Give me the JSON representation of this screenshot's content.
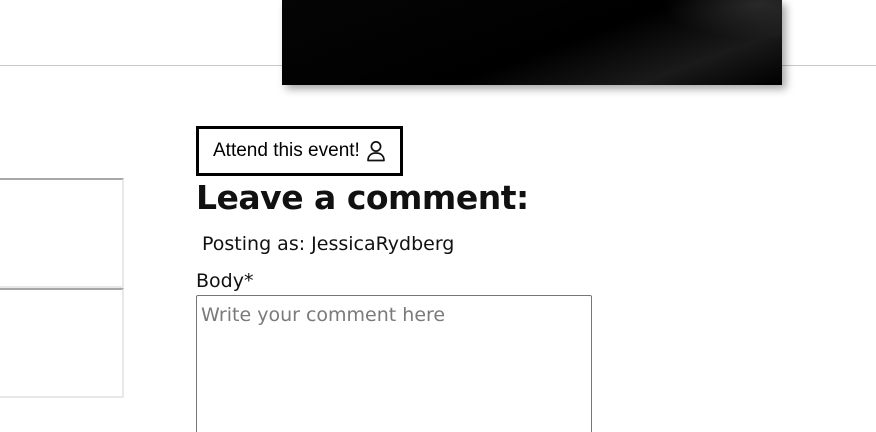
{
  "event": {
    "attend_label": "Attend this event!",
    "attend_icon": "user-icon"
  },
  "comments": {
    "heading": "Leave a comment:",
    "posting_as": "Posting as: JessicaRydberg",
    "body_label": "Body*",
    "body_placeholder": "Write your comment here",
    "body_value": ""
  },
  "colors": {
    "border": "#000000",
    "divider": "#c8c8c8",
    "placeholder": "#7a7a7a"
  }
}
